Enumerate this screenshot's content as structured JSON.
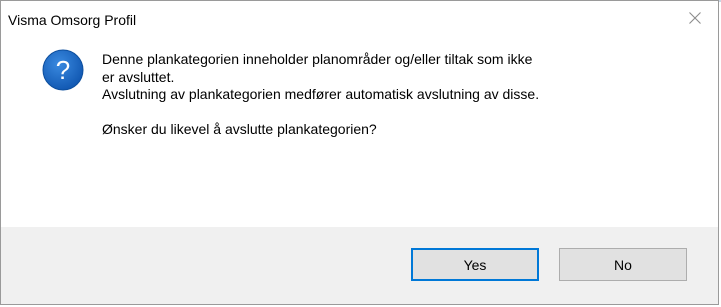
{
  "window": {
    "title": "Visma Omsorg Profil"
  },
  "dialog": {
    "icon": "question-icon",
    "message_lines": [
      "Denne plankategorien inneholder planområder og/eller tiltak som ikke",
      "er avsluttet.",
      "Avslutning av plankategorien medfører automatisk avslutning av disse.",
      "Ønsker du likevel å avslutte plankategorien?"
    ]
  },
  "buttons": {
    "yes_label": "Yes",
    "no_label": "No"
  },
  "colors": {
    "icon_blue": "#1a6dc4",
    "default_button_border": "#0078d7",
    "footer_bg": "#f0f0f0"
  }
}
